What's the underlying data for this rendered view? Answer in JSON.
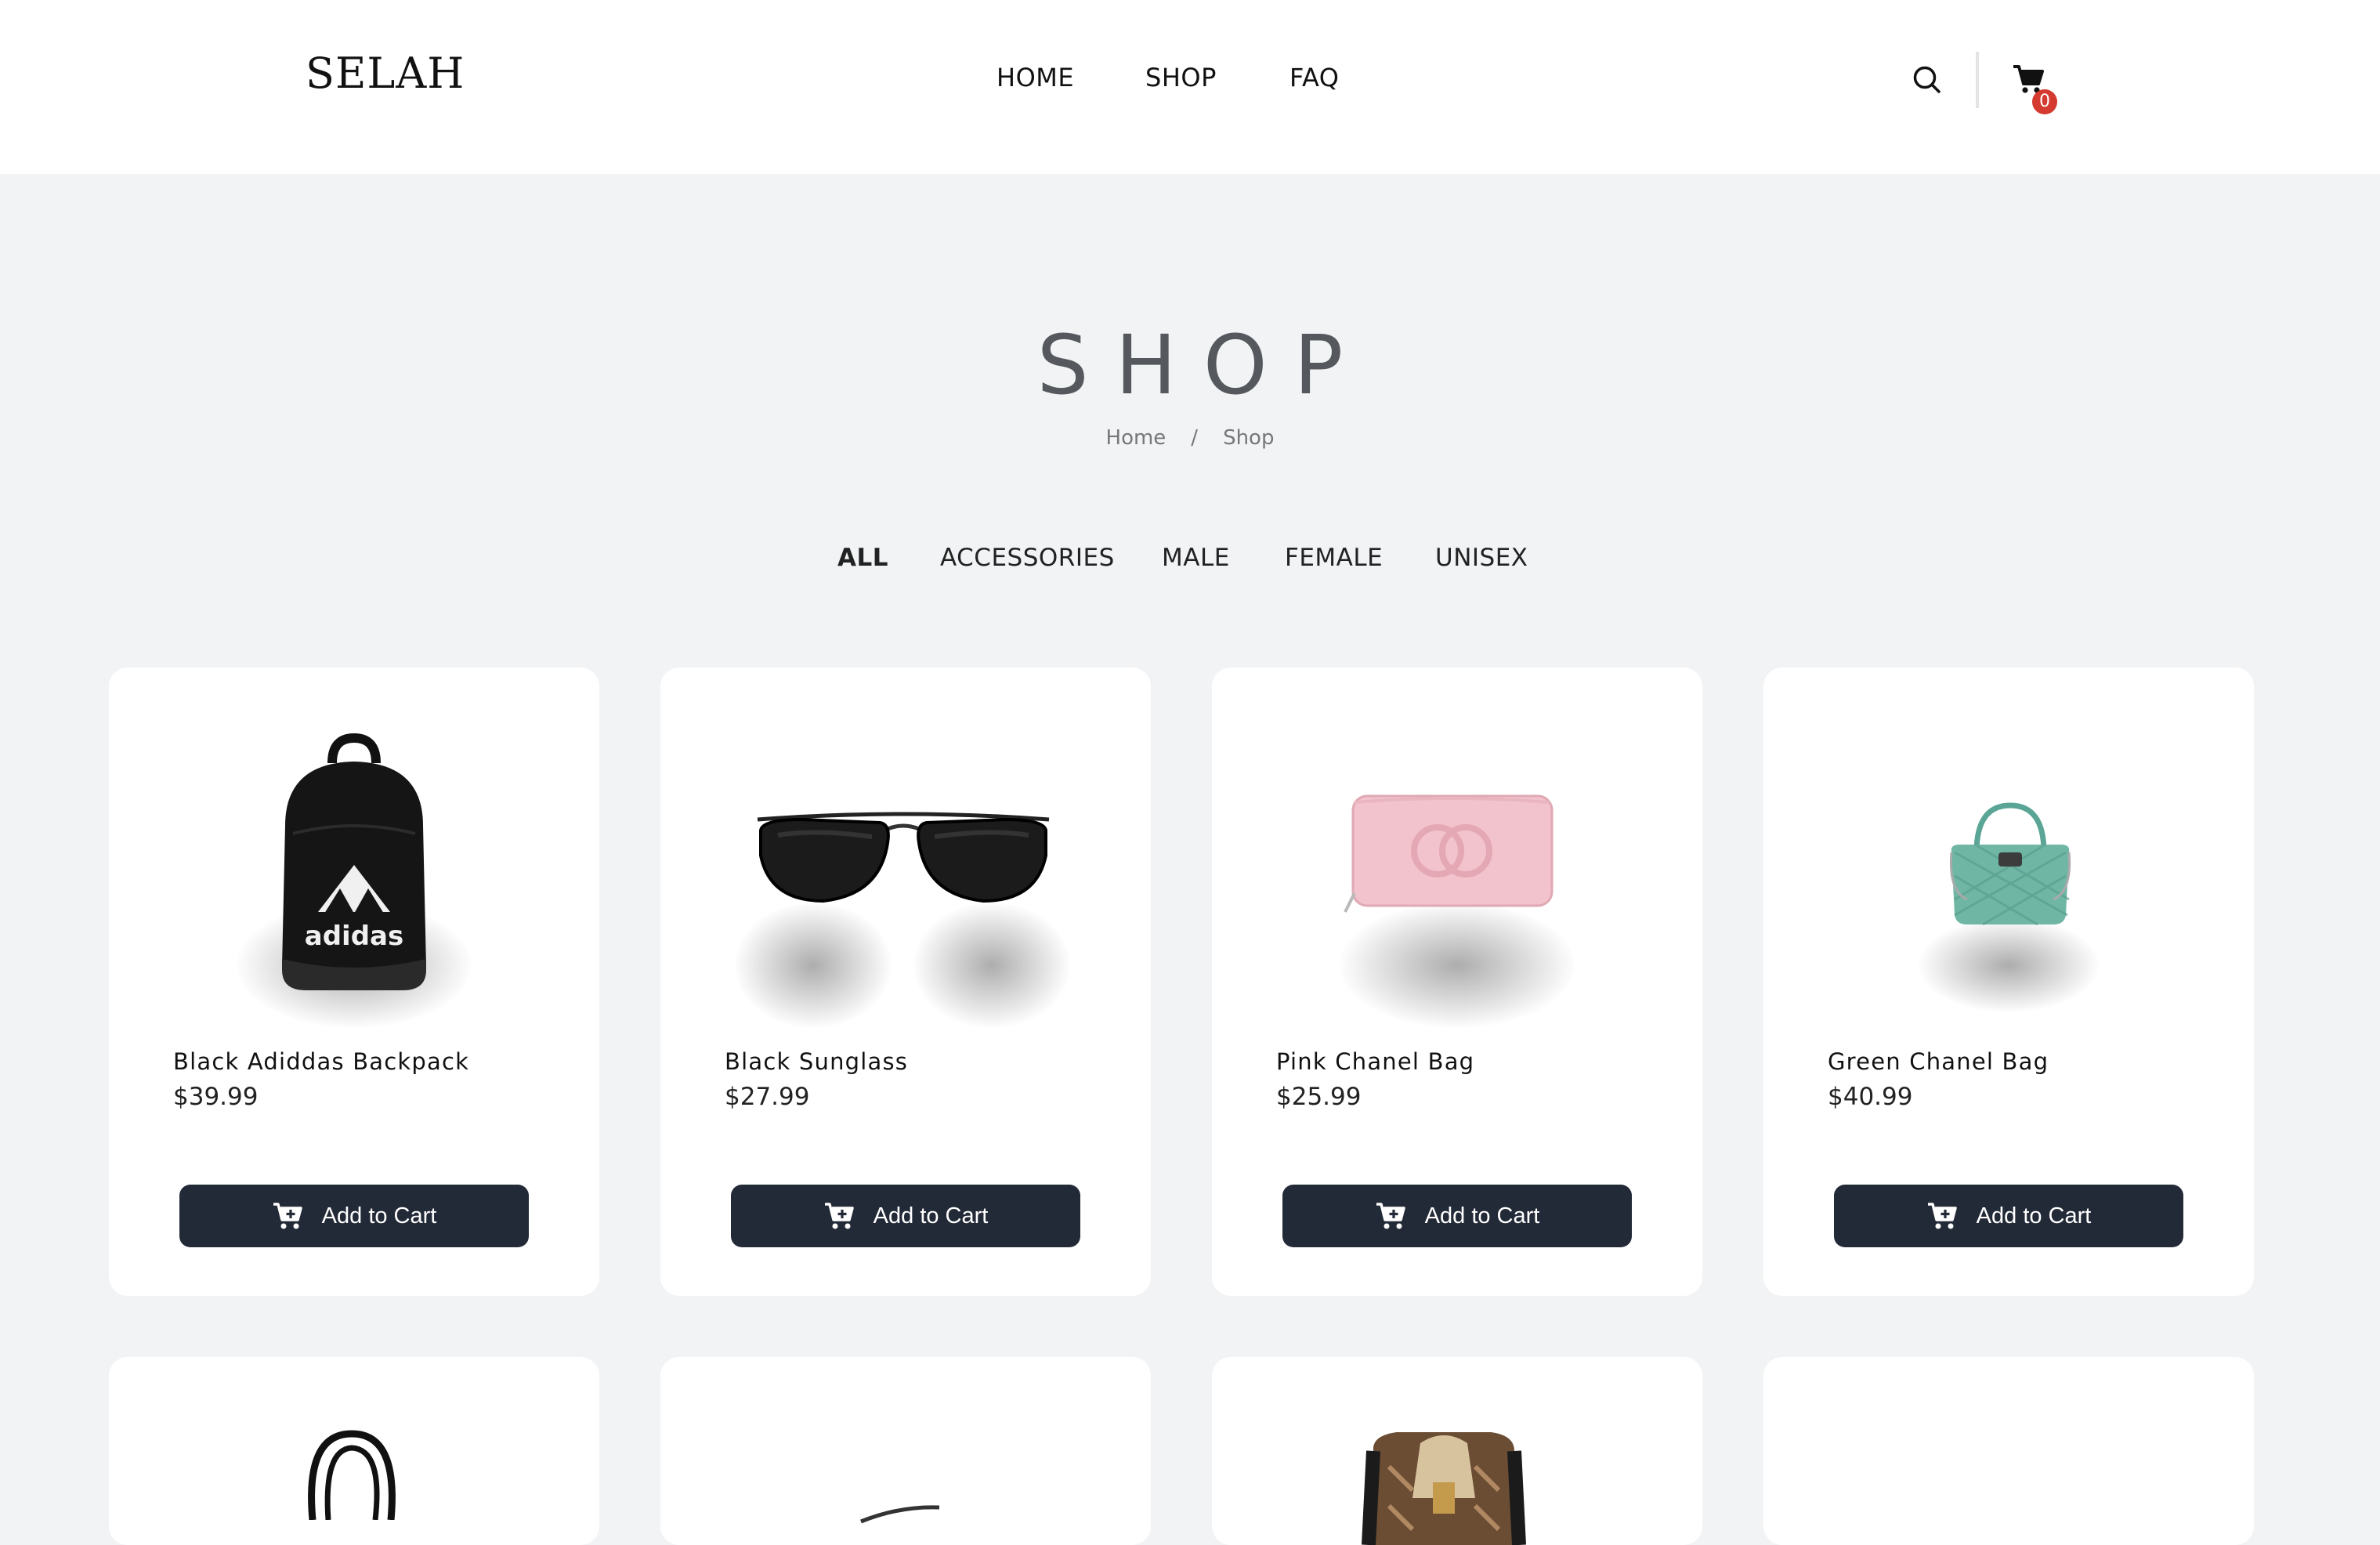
{
  "header": {
    "logo": "SELAH",
    "nav": [
      {
        "label": "HOME"
      },
      {
        "label": "SHOP"
      },
      {
        "label": "FAQ"
      }
    ],
    "cart_count": "0",
    "icons": {
      "search": "search-icon",
      "cart": "cart-icon"
    }
  },
  "hero": {
    "title": "SHOP",
    "breadcrumb": {
      "home": "Home",
      "separator": "/",
      "current": "Shop"
    }
  },
  "filters": [
    {
      "label": "ALL",
      "active": true
    },
    {
      "label": "ACCESSORIES",
      "active": false
    },
    {
      "label": "MALE",
      "active": false
    },
    {
      "label": "FEMALE",
      "active": false
    },
    {
      "label": "UNISEX",
      "active": false
    }
  ],
  "products": [
    {
      "name": "Black Adiddas Backpack",
      "price": "$39.99",
      "button": "Add to Cart",
      "image": "backpack-image"
    },
    {
      "name": "Black Sunglass",
      "price": "$27.99",
      "button": "Add to Cart",
      "image": "sunglasses-image"
    },
    {
      "name": "Pink Chanel Bag",
      "price": "$25.99",
      "button": "Add to Cart",
      "image": "pink-wallet-image"
    },
    {
      "name": "Green Chanel Bag",
      "price": "$40.99",
      "button": "Add to Cart",
      "image": "green-handbag-image"
    }
  ],
  "colors": {
    "page_bg": "#f2f3f5",
    "button_bg": "#232a37",
    "badge": "#d43a2f"
  }
}
